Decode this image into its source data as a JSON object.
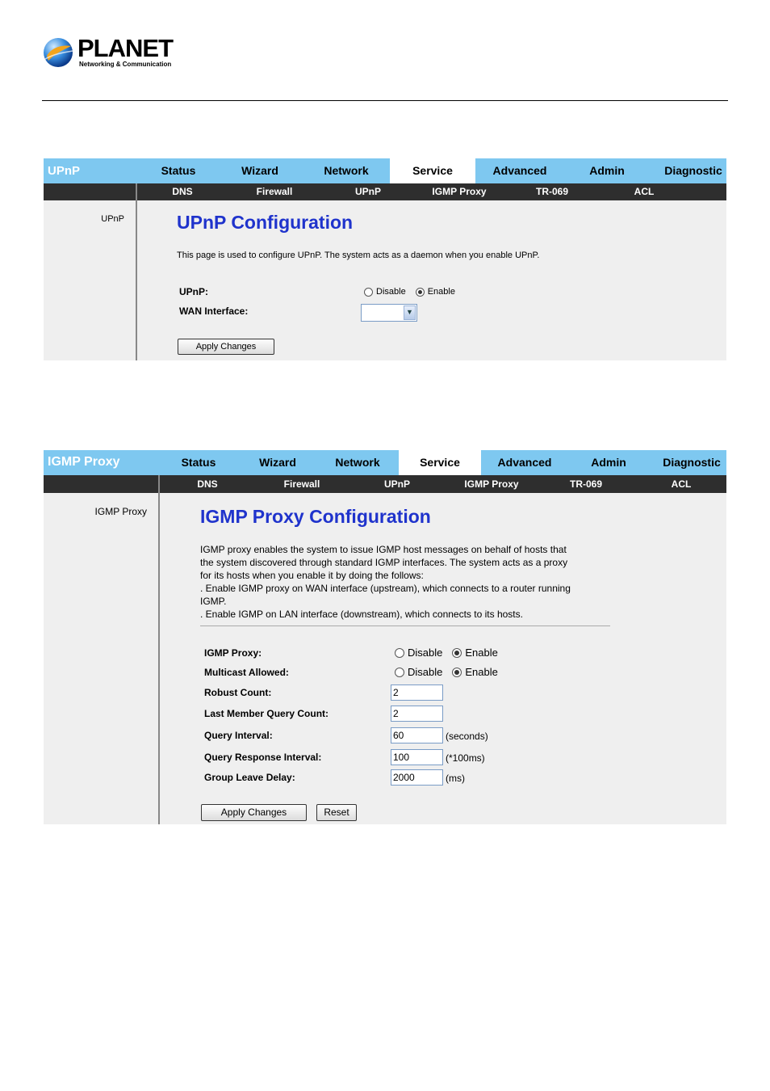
{
  "brand": {
    "name": "PLANET",
    "tagline": "Networking & Communication"
  },
  "panel1": {
    "section": "UPnP",
    "tabs": [
      "Status",
      "Wizard",
      "Network",
      "Service",
      "Advanced",
      "Admin",
      "Diagnostic"
    ],
    "active_tab": "Service",
    "subtabs": [
      "DNS",
      "Firewall",
      "UPnP",
      "IGMP Proxy",
      "TR-069",
      "ACL"
    ],
    "nav_item": "UPnP",
    "title": "UPnP Configuration",
    "description": "This page is used to configure UPnP. The system acts as a daemon when you enable UPnP.",
    "upnp_label": "UPnP:",
    "disable_label": "Disable",
    "enable_label": "Enable",
    "upnp_value": "Enable",
    "wan_label": "WAN Interface:",
    "wan_value": "",
    "apply_label": "Apply Changes"
  },
  "panel2": {
    "section": "IGMP Proxy",
    "tabs": [
      "Status",
      "Wizard",
      "Network",
      "Service",
      "Advanced",
      "Admin",
      "Diagnostic"
    ],
    "active_tab": "Service",
    "subtabs": [
      "DNS",
      "Firewall",
      "UPnP",
      "IGMP Proxy",
      "TR-069",
      "ACL"
    ],
    "nav_item": "IGMP Proxy",
    "title": "IGMP Proxy Configuration",
    "description_lines": [
      "IGMP proxy enables the system to issue IGMP host messages on behalf of hosts that",
      "the system discovered through standard IGMP interfaces. The system acts as a proxy",
      "for its hosts when you enable it by doing the follows:",
      ". Enable IGMP proxy on WAN interface (upstream), which connects to a router running",
      "IGMP.",
      ". Enable IGMP on LAN interface (downstream), which connects to its hosts."
    ],
    "disable_label": "Disable",
    "enable_label": "Enable",
    "igmp_proxy_label": "IGMP Proxy:",
    "igmp_proxy_value": "Enable",
    "multicast_label": "Multicast Allowed:",
    "multicast_value": "Enable",
    "fields": [
      {
        "label": "Robust Count:",
        "value": "2",
        "unit": ""
      },
      {
        "label": "Last Member Query Count:",
        "value": "2",
        "unit": ""
      },
      {
        "label": "Query Interval:",
        "value": "60",
        "unit": "(seconds)"
      },
      {
        "label": "Query Response Interval:",
        "value": "100",
        "unit": "(*100ms)"
      },
      {
        "label": "Group Leave Delay:",
        "value": "2000",
        "unit": "(ms)"
      }
    ],
    "apply_label": "Apply Changes",
    "reset_label": "Reset"
  },
  "colors": {
    "tab_bar": "#7ec8f0",
    "sub_bar": "#2e2e2e",
    "body": "#efefef",
    "title": "#1f33cc"
  }
}
